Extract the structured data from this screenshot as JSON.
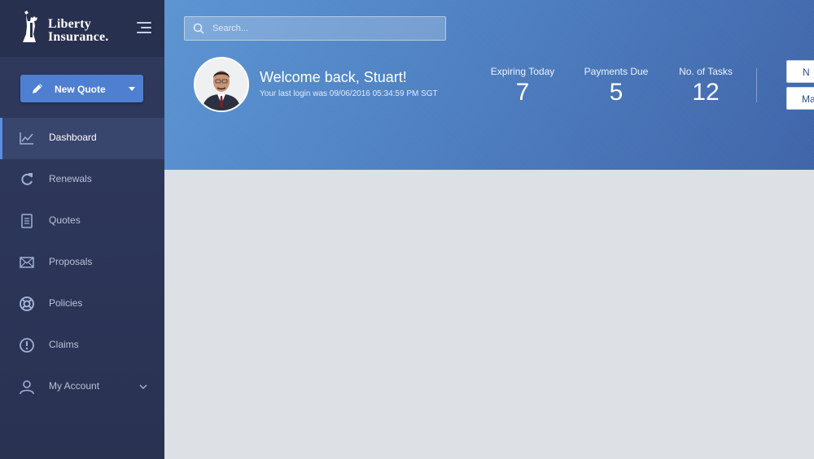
{
  "brand": {
    "line1": "Liberty",
    "line2": "Insurance."
  },
  "sidebar": {
    "new_quote_label": "New Quote",
    "items": [
      {
        "label": "Dashboard",
        "icon": "chart-line-icon",
        "active": true
      },
      {
        "label": "Renewals",
        "icon": "refresh-icon"
      },
      {
        "label": "Quotes",
        "icon": "document-icon"
      },
      {
        "label": "Proposals",
        "icon": "envelope-icon"
      },
      {
        "label": "Policies",
        "icon": "lifebuoy-icon"
      },
      {
        "label": "Claims",
        "icon": "alert-circle-icon"
      },
      {
        "label": "My Account",
        "icon": "user-icon"
      }
    ]
  },
  "header": {
    "search_placeholder": "Search...",
    "welcome": "Welcome back, Stuart!",
    "last_login": "Your last login was 09/06/2016 05:34:59 PM SGT",
    "stats": [
      {
        "label": "Expiring Today",
        "value": "7"
      },
      {
        "label": "Payments Due",
        "value": "5"
      },
      {
        "label": "No. of Tasks",
        "value": "12"
      }
    ],
    "buttons": [
      "N",
      "Ma"
    ]
  },
  "colors": {
    "accent": "#4e7fd0",
    "sidebar": "#2c3557",
    "header": "#4f82c3",
    "content_bg": "#dde0e5"
  }
}
